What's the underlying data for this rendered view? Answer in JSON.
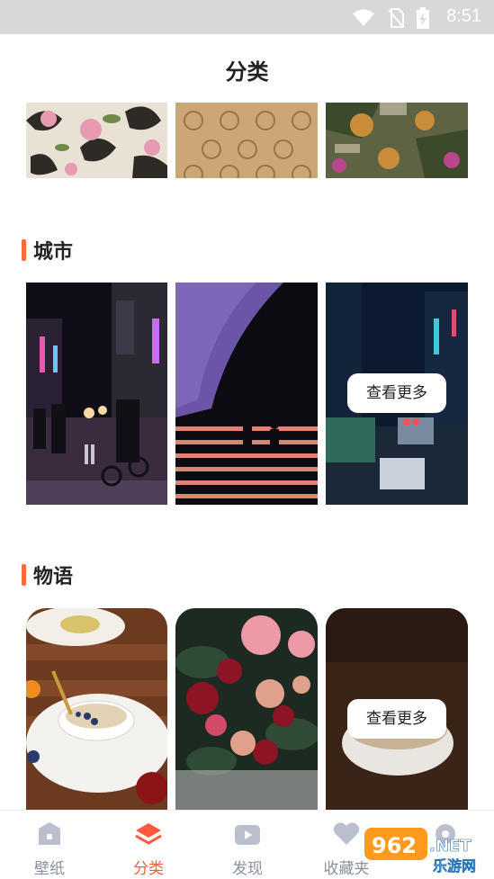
{
  "status_bar": {
    "time": "8:51"
  },
  "header": {
    "title": "分类"
  },
  "sections": [
    {
      "title": "城市",
      "more_label": "查看更多"
    },
    {
      "title": "物语",
      "more_label": "查看更多"
    }
  ],
  "tabbar": {
    "tabs": [
      {
        "label": "壁纸",
        "active": false
      },
      {
        "label": "分类",
        "active": true
      },
      {
        "label": "发现",
        "active": false
      },
      {
        "label": "收藏夹",
        "active": false
      },
      {
        "label": "设置",
        "active": false
      }
    ]
  },
  "watermark": {
    "brand": "962.NET",
    "sub": "乐游网"
  },
  "colors": {
    "accent": "#ff5a3c",
    "section_bar": "#ff6b3d",
    "tab_inactive": "#8a8f9c"
  }
}
